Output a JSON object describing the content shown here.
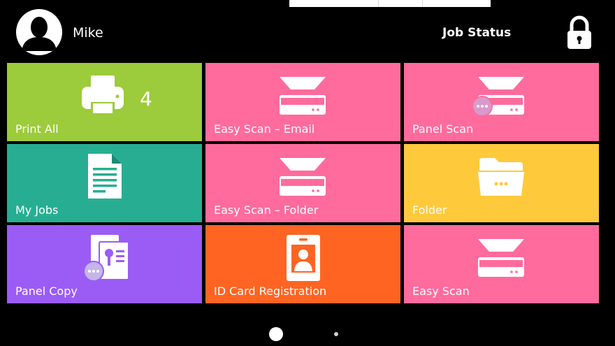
{
  "header": {
    "user_name": "Mike",
    "job_status_label": "Job Status"
  },
  "tiles": [
    {
      "label": "Print All",
      "badge": "4",
      "color": "#9ccb3b",
      "icon": "printer-icon"
    },
    {
      "label": "Easy Scan – Email",
      "color": "#ff6b9d",
      "icon": "scanner-icon"
    },
    {
      "label": "Panel Scan",
      "color": "#ff6b9d",
      "icon": "scanner-more-icon"
    },
    {
      "label": "My Jobs",
      "color": "#27ae92",
      "icon": "document-icon"
    },
    {
      "label": "Easy Scan – Folder",
      "color": "#ff6b9d",
      "icon": "scanner-icon"
    },
    {
      "label": "Folder",
      "color": "#ffc93c",
      "icon": "folder-icon"
    },
    {
      "label": "Panel Copy",
      "color": "#9b5cf6",
      "icon": "copy-more-icon"
    },
    {
      "label": "ID Card Registration",
      "color": "#ff6422",
      "icon": "id-card-icon"
    },
    {
      "label": "Easy Scan",
      "color": "#ff6b9d",
      "icon": "scanner-icon"
    }
  ],
  "pager": {
    "pages": 2,
    "active_page": 1
  }
}
